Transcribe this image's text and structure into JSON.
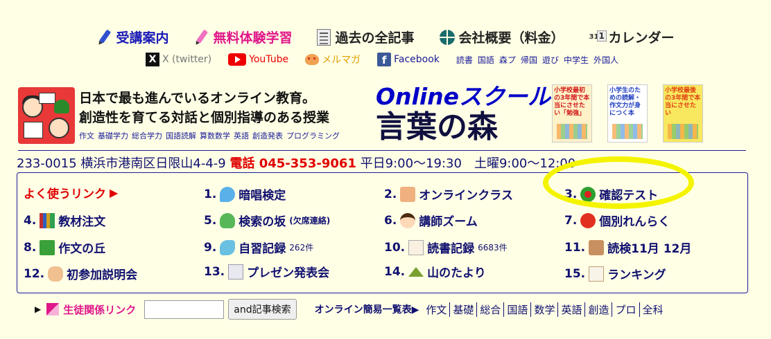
{
  "nav": [
    {
      "label": "受講案内",
      "icon": "blue-pen-icon",
      "color": "#1a1ab8"
    },
    {
      "label": "無料体験学習",
      "icon": "pink-pen-icon",
      "color": "#e0178a"
    },
    {
      "label": "過去の全記事",
      "icon": "newspaper-icon",
      "color": "#222222"
    },
    {
      "label": "会社概要（料金）",
      "icon": "globe-icon",
      "color": "#222222"
    },
    {
      "label": "カレンダー",
      "icon": "calendar-icon",
      "color": "#222222"
    }
  ],
  "social": {
    "twitter": "X (twitter)",
    "youtube": "YouTube",
    "mailmag": "メルマガ",
    "facebook": "Facebook",
    "x_glyph": "X",
    "fb_glyph": "f"
  },
  "categories": [
    "読書",
    "国語",
    "森プ",
    "帰国",
    "遊び",
    "中学生",
    "外国人"
  ],
  "header": {
    "tagline1": "日本で最も進んでいるオンライン教育。",
    "tagline2": "創造性を育てる対話と個別指導のある授業",
    "subjects": [
      "作文",
      "基礎学力",
      "総合学力",
      "国語読解",
      "算数数学",
      "英語",
      "創造発表",
      "プログラミング"
    ],
    "brand_line1": "Onlineスクール",
    "brand_line2": "言葉の森"
  },
  "books": [
    {
      "title": "小学校最初の3年間で本当にさせたい「勉強」",
      "icon": "book-cover-1"
    },
    {
      "title": "小学生のための読解・作文力が身につく本",
      "icon": "book-cover-2"
    },
    {
      "title": "小学校最後の3年間で本当にさせたい",
      "icon": "book-cover-3"
    }
  ],
  "address": {
    "text": "233-0015 横浜市港南区日限山4-4-9",
    "tel_label": "電話 045-353-9061",
    "hours": "平日9:00～19:30　土曜9:00～12:00"
  },
  "links": {
    "title": "よく使うリンク",
    "title_arrow": "▶",
    "items": [
      {
        "num": "1.",
        "label": "暗唱検定",
        "icon": "bird-icon",
        "note": ""
      },
      {
        "num": "2.",
        "label": "オンラインクラス",
        "icon": "people-icon",
        "note": ""
      },
      {
        "num": "3.",
        "label": "確認テスト",
        "icon": "clover-icon",
        "note": ""
      },
      {
        "num": "4.",
        "label": "教材注文",
        "icon": "books-icon",
        "note": ""
      },
      {
        "num": "5.",
        "label": "検索の坂",
        "icon": "tree-icon",
        "note": "(欠席連絡)"
      },
      {
        "num": "6.",
        "label": "講師ズーム",
        "icon": "teacher-icon",
        "note": ""
      },
      {
        "num": "7.",
        "label": "個別れんらく",
        "icon": "tomato-icon",
        "note": ""
      },
      {
        "num": "8.",
        "label": "作文の丘",
        "icon": "hill-icon",
        "note": ""
      },
      {
        "num": "9.",
        "label": "自習記録",
        "icon": "fish-icon",
        "note": "262件"
      },
      {
        "num": "10.",
        "label": "読書記録",
        "icon": "paper-icon",
        "note": "6683件"
      },
      {
        "num": "11.",
        "label": "読検11月 12月",
        "icon": "desk-icon",
        "note": ""
      },
      {
        "num": "12.",
        "label": "初参加説明会",
        "icon": "kids-icon",
        "note": ""
      },
      {
        "num": "13.",
        "label": "プレゼン発表会",
        "icon": "slides-icon",
        "note": ""
      },
      {
        "num": "14.",
        "label": "山のたより",
        "icon": "mountain-icon",
        "note": ""
      },
      {
        "num": "15.",
        "label": "ランキング",
        "icon": "ranking-icon",
        "note": ""
      }
    ]
  },
  "bottom": {
    "arrow": "▶",
    "student_link": "生徒関係リンク",
    "search_value": "",
    "search_button": "and記事検索",
    "quick_label": "オンライン簡易一覧表▶",
    "quick_items": [
      "作文",
      "基礎",
      "総合",
      "国語",
      "数学",
      "英語",
      "創造",
      "プロ",
      "全科"
    ]
  },
  "colors": {
    "background": "#ffffe6",
    "accent_blue": "#1a1ab8",
    "accent_pink": "#e0178a",
    "tel_red": "#e00000",
    "highlight_yellow": "#f4f400"
  }
}
